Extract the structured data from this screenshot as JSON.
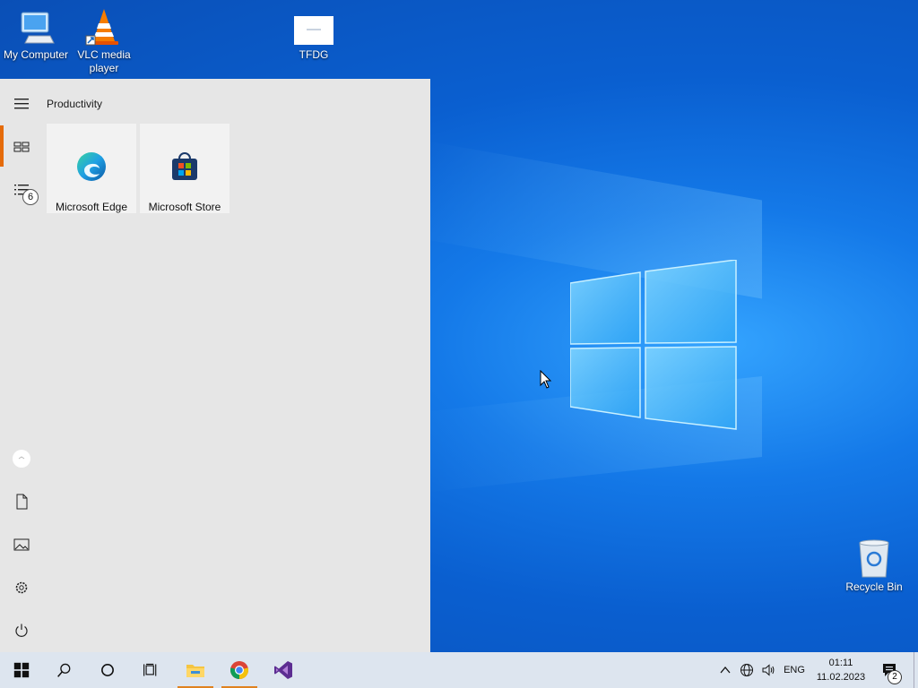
{
  "desktop": {
    "icons": [
      {
        "label": "My Computer"
      },
      {
        "label": "VLC media player"
      },
      {
        "label": "TFDG"
      },
      {
        "label": "Recycle Bin"
      }
    ]
  },
  "start_menu": {
    "group_title": "Productivity",
    "tiles": [
      {
        "label": "Microsoft Edge"
      },
      {
        "label": "Microsoft Store"
      }
    ],
    "recent_badge": "6"
  },
  "taskbar": {
    "tray": {
      "language": "ENG",
      "time": "01:11",
      "date": "11.02.2023",
      "notification_count": "2"
    }
  },
  "colors": {
    "accent": "#e56b0a",
    "start_bg": "#e6e6e6",
    "taskbar_bg": "#dde5ef"
  }
}
